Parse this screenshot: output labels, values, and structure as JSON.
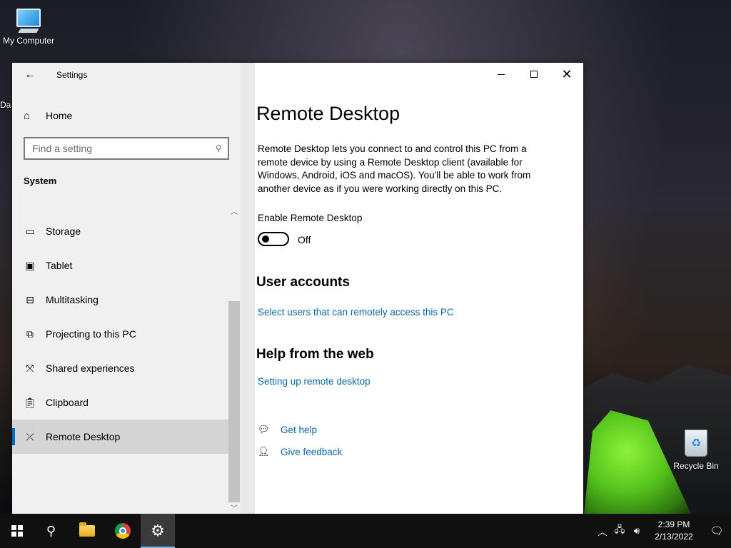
{
  "desktop": {
    "icons": {
      "my_computer": "My Computer",
      "recycle_bin": "Recycle Bin"
    },
    "partial_label": "Da"
  },
  "window": {
    "app_title": "Settings",
    "caption": {
      "minimize_icon": "minimize-icon",
      "maximize_icon": "maximize-icon",
      "close_icon": "close-icon"
    }
  },
  "nav": {
    "home": "Home",
    "search_placeholder": "Find a setting",
    "section": "System",
    "items": [
      {
        "label": "Storage",
        "icon": "storage-icon"
      },
      {
        "label": "Tablet",
        "icon": "tablet-icon"
      },
      {
        "label": "Multitasking",
        "icon": "multitasking-icon"
      },
      {
        "label": "Projecting to this PC",
        "icon": "projecting-icon"
      },
      {
        "label": "Shared experiences",
        "icon": "shared-experiences-icon"
      },
      {
        "label": "Clipboard",
        "icon": "clipboard-icon"
      },
      {
        "label": "Remote Desktop",
        "icon": "remote-desktop-icon",
        "active": true
      }
    ]
  },
  "content": {
    "title": "Remote Desktop",
    "description": "Remote Desktop lets you connect to and control this PC from a remote device by using a Remote Desktop client (available for Windows, Android, iOS and macOS). You'll be able to work from another device as if you were working directly on this PC.",
    "enable_label": "Enable Remote Desktop",
    "toggle_state": "Off",
    "user_accounts_heading": "User accounts",
    "select_users_link": "Select users that can remotely access this PC",
    "help_heading": "Help from the web",
    "setup_link": "Setting up remote desktop",
    "get_help": "Get help",
    "give_feedback": "Give feedback"
  },
  "taskbar": {
    "time": "2:39 PM",
    "date": "2/13/2022"
  },
  "colors": {
    "accent": "#0067c0",
    "link": "#0b66a8",
    "nav_bg": "#f0f0f0",
    "active_item_bg": "#d5d5d5",
    "taskbar_bg": "#101010"
  }
}
